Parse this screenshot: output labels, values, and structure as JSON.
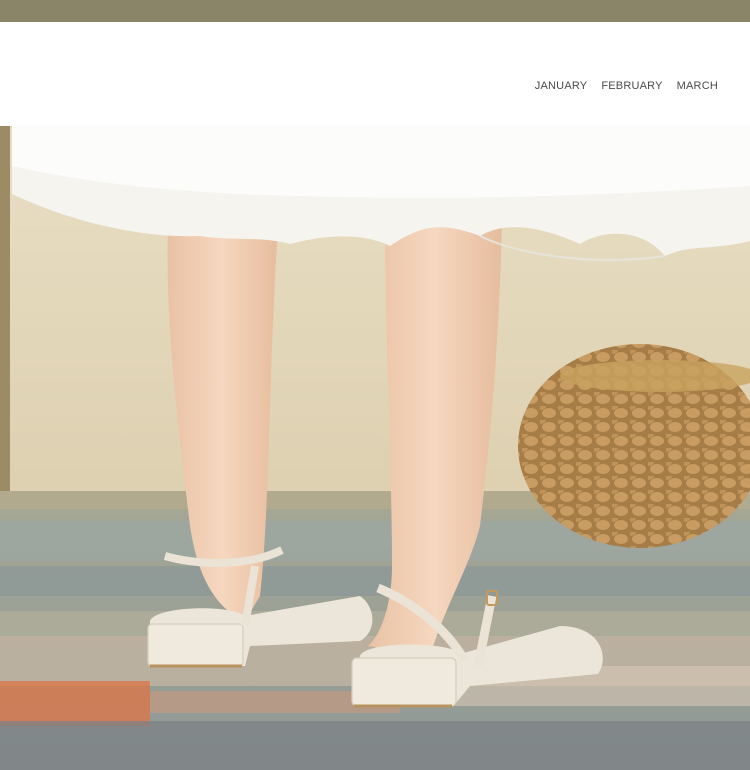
{
  "header": {
    "months": [
      "JANUARY",
      "FEBRUARY",
      "MARCH"
    ]
  },
  "photo": {
    "alt_subject": "legs-in-white-skirt-wearing-cream-slingback-heels",
    "colors": {
      "top_band": "#8a8468",
      "wall": "#e8dcc0",
      "skirt": "#f4f2ec",
      "skin": "#f2cfb3",
      "shoe": "#ece6da",
      "basket": "#b58d55",
      "rug_blue": "#8fa0a0",
      "rug_orange": "#d9774a"
    }
  }
}
